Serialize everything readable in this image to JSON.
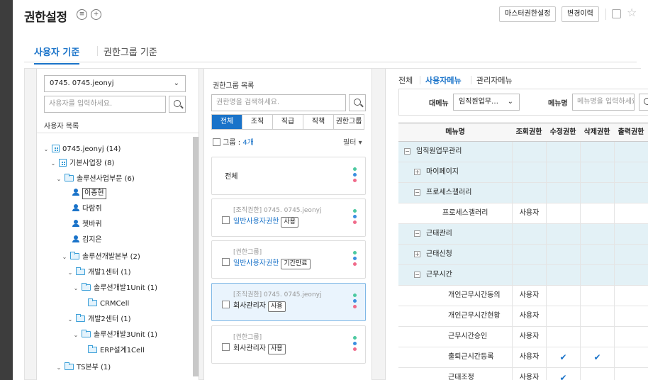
{
  "header": {
    "title": "권한설정",
    "buttons": {
      "master": "마스터권한설정",
      "history": "변경이력"
    }
  },
  "tabs": {
    "user": "사용자 기준",
    "group": "권한그룹 기준"
  },
  "left": {
    "account_select": "0745. 0745.jeonyj",
    "search_placeholder": "사용자를 입력하세요.",
    "list_title": "사용자 목록",
    "tree": [
      {
        "label": "0745.jeonyj (14)"
      },
      {
        "label": "기본사업장 (8)"
      },
      {
        "label": "솔루션사업부문 (6)"
      },
      {
        "label": "이종현"
      },
      {
        "label": "다람쥐"
      },
      {
        "label": "쳇바퀴"
      },
      {
        "label": "김지은"
      },
      {
        "label": "솔루션개발본부 (2)"
      },
      {
        "label": "개발1센터 (1)"
      },
      {
        "label": "솔루션개발1Unit (1)"
      },
      {
        "label": "CRMCell"
      },
      {
        "label": "개발2센터 (1)"
      },
      {
        "label": "솔루션개발3Unit (1)"
      },
      {
        "label": "ERP설계1Cell"
      },
      {
        "label": "TS본부 (1)"
      }
    ]
  },
  "middle": {
    "title": "권한그룹 목록",
    "search_placeholder": "권한명을 검색하세요.",
    "segments": [
      "전체",
      "조직",
      "직급",
      "직책",
      "권한그룹"
    ],
    "group_prefix": "그룹 : ",
    "group_count": "4개",
    "filter": "필터 ▾",
    "all_card": "전체",
    "cards": [
      {
        "sub": "[조직권한] 0745. 0745.jeonyj",
        "name": "일반사용자권한",
        "tag": "사용"
      },
      {
        "sub": "[권한그룹]",
        "name": "일반사용자권한",
        "tag": "기간만료"
      },
      {
        "sub": "[조직권한] 0745. 0745.jeonyj",
        "name": "회사관리자",
        "tag": "사용"
      },
      {
        "sub": "[권한그룹]",
        "name": "회사관리자",
        "tag": "사용"
      }
    ],
    "dot_colors": [
      "#4cc9a0",
      "#3b8fe0",
      "#f06a8a"
    ]
  },
  "right": {
    "tabs": [
      "전체",
      "사용자메뉴",
      "관리자메뉴"
    ],
    "big_menu_label": "대메뉴",
    "big_menu_value": "임직원업무…",
    "menu_name_label": "메뉴명",
    "menu_name_placeholder": "메뉴명을 입력하세요",
    "columns": [
      "메뉴명",
      "조회권한",
      "수정권한",
      "삭제권한",
      "출력권한"
    ],
    "rows": [
      {
        "name": "임직원업무관리",
        "level": 0,
        "toggle": "−",
        "view": "",
        "edit": "",
        "del": "",
        "print": "",
        "group": true
      },
      {
        "name": "마이페이지",
        "level": 1,
        "toggle": "+",
        "view": "",
        "edit": "",
        "del": "",
        "print": "",
        "group": true
      },
      {
        "name": "프로세스갤러리",
        "level": 1,
        "toggle": "−",
        "view": "",
        "edit": "",
        "del": "",
        "print": "",
        "group": true
      },
      {
        "name": "프로세스갤러리",
        "level": 2,
        "toggle": "",
        "view": "사용자",
        "edit": "",
        "del": "",
        "print": "",
        "group": false
      },
      {
        "name": "근태관리",
        "level": 1,
        "toggle": "−",
        "view": "",
        "edit": "",
        "del": "",
        "print": "",
        "group": true
      },
      {
        "name": "근태신청",
        "level": 2,
        "toggle": "+",
        "view": "",
        "edit": "",
        "del": "",
        "print": "",
        "group": true
      },
      {
        "name": "근무시간",
        "level": 2,
        "toggle": "−",
        "view": "",
        "edit": "",
        "del": "",
        "print": "",
        "group": true
      },
      {
        "name": "개인근무시간동의",
        "level": 3,
        "toggle": "",
        "view": "사용자",
        "edit": "",
        "del": "",
        "print": "",
        "group": false
      },
      {
        "name": "개인근무시간현황",
        "level": 3,
        "toggle": "",
        "view": "사용자",
        "edit": "",
        "del": "",
        "print": "",
        "group": false
      },
      {
        "name": "근무시간승인",
        "level": 3,
        "toggle": "",
        "view": "사용자",
        "edit": "",
        "del": "",
        "print": "",
        "group": false
      },
      {
        "name": "출퇴근시간등록",
        "level": 3,
        "toggle": "",
        "view": "사용자",
        "edit": "✔",
        "del": "✔",
        "print": "",
        "group": false
      },
      {
        "name": "근태조정",
        "level": 3,
        "toggle": "",
        "view": "사용자",
        "edit": "✔",
        "del": "",
        "print": "",
        "group": false
      }
    ]
  }
}
